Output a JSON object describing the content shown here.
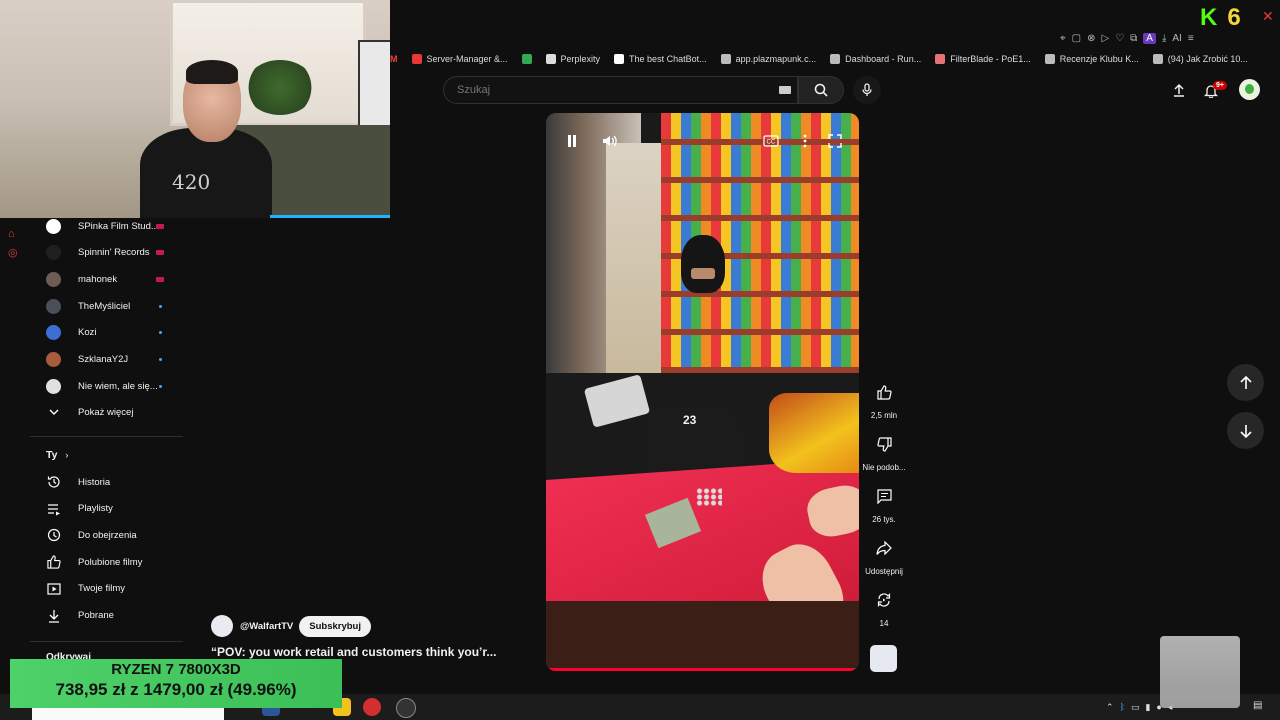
{
  "browser": {
    "bookmarks": [
      {
        "label": "Server-Manager &...",
        "color": "#e53935"
      },
      {
        "label": "",
        "color": "#34a853"
      },
      {
        "label": "Perplexity",
        "color": "#dddddd"
      },
      {
        "label": "The best ChatBot...",
        "color": "#ffffff"
      },
      {
        "label": "app.plazmapunk.c...",
        "color": "#bbbbbb"
      },
      {
        "label": "Dashboard - Run...",
        "color": "#bbbbbb"
      },
      {
        "label": "FilterBlade - PoE1...",
        "color": "#e57373"
      },
      {
        "label": "Recenzje Klubu K...",
        "color": "#bbbbbb"
      },
      {
        "label": "(94) Jak Zrobić 10...",
        "color": "#bbbbbb"
      }
    ],
    "gmail_label": "M",
    "extension_ai": "AI",
    "overlay_k": "K",
    "overlay_number": "6"
  },
  "header": {
    "search_placeholder": "Szukaj",
    "notification_count": "9+"
  },
  "sidebar": {
    "subscriptions": [
      {
        "label": "SPinka Film Stud...",
        "avatar": "#ffffff",
        "indicator": "live"
      },
      {
        "label": "Spinnin' Records",
        "avatar": "#1f1f1f",
        "indicator": "live"
      },
      {
        "label": "mahonek",
        "avatar": "#6d5c55",
        "indicator": "live"
      },
      {
        "label": "TheMyśliciel",
        "avatar": "#4a4e58",
        "indicator": "dot"
      },
      {
        "label": "Kozi",
        "avatar": "#3b6fd4",
        "indicator": "dot"
      },
      {
        "label": "SzklanaY2J",
        "avatar": "#a85c3c",
        "indicator": "dot"
      },
      {
        "label": "Nie wiem, ale się...",
        "avatar": "#e0e0e0",
        "indicator": "dot"
      }
    ],
    "show_more": "Pokaż więcej",
    "you_section": "Ty",
    "you_items": [
      {
        "label": "Historia",
        "icon": "history-icon"
      },
      {
        "label": "Playlisty",
        "icon": "playlist-icon"
      },
      {
        "label": "Do obejrzenia",
        "icon": "watch-later-icon"
      },
      {
        "label": "Polubione filmy",
        "icon": "thumb-up-icon"
      },
      {
        "label": "Twoje filmy",
        "icon": "your-videos-icon"
      },
      {
        "label": "Pobrane",
        "icon": "download-icon"
      }
    ],
    "explore_section": "Odkrywaj"
  },
  "short": {
    "channel_handle": "@WalfartTV",
    "subscribe_label": "Subskrybuj",
    "title": "“POV: you work retail and customers think you’r...",
    "progress": 0.985,
    "actions": {
      "likes": "2,5 mln",
      "dislike": "Nie podob...",
      "comments": "26 tys.",
      "share": "Udostępnij",
      "remix": "14"
    },
    "shirt_number": "23"
  },
  "promo": {
    "line1": "RYZEN 7 7800X3D",
    "line2": "738,95 zł z 1479,00 zł (49.96%)"
  },
  "webcam": {
    "shirt_text": "420"
  },
  "colors": {
    "accent": "#ff0033",
    "background": "#0f0f0f",
    "live": "#c2185b",
    "new_dot": "#3ea6ff",
    "promo": "#47c960"
  }
}
